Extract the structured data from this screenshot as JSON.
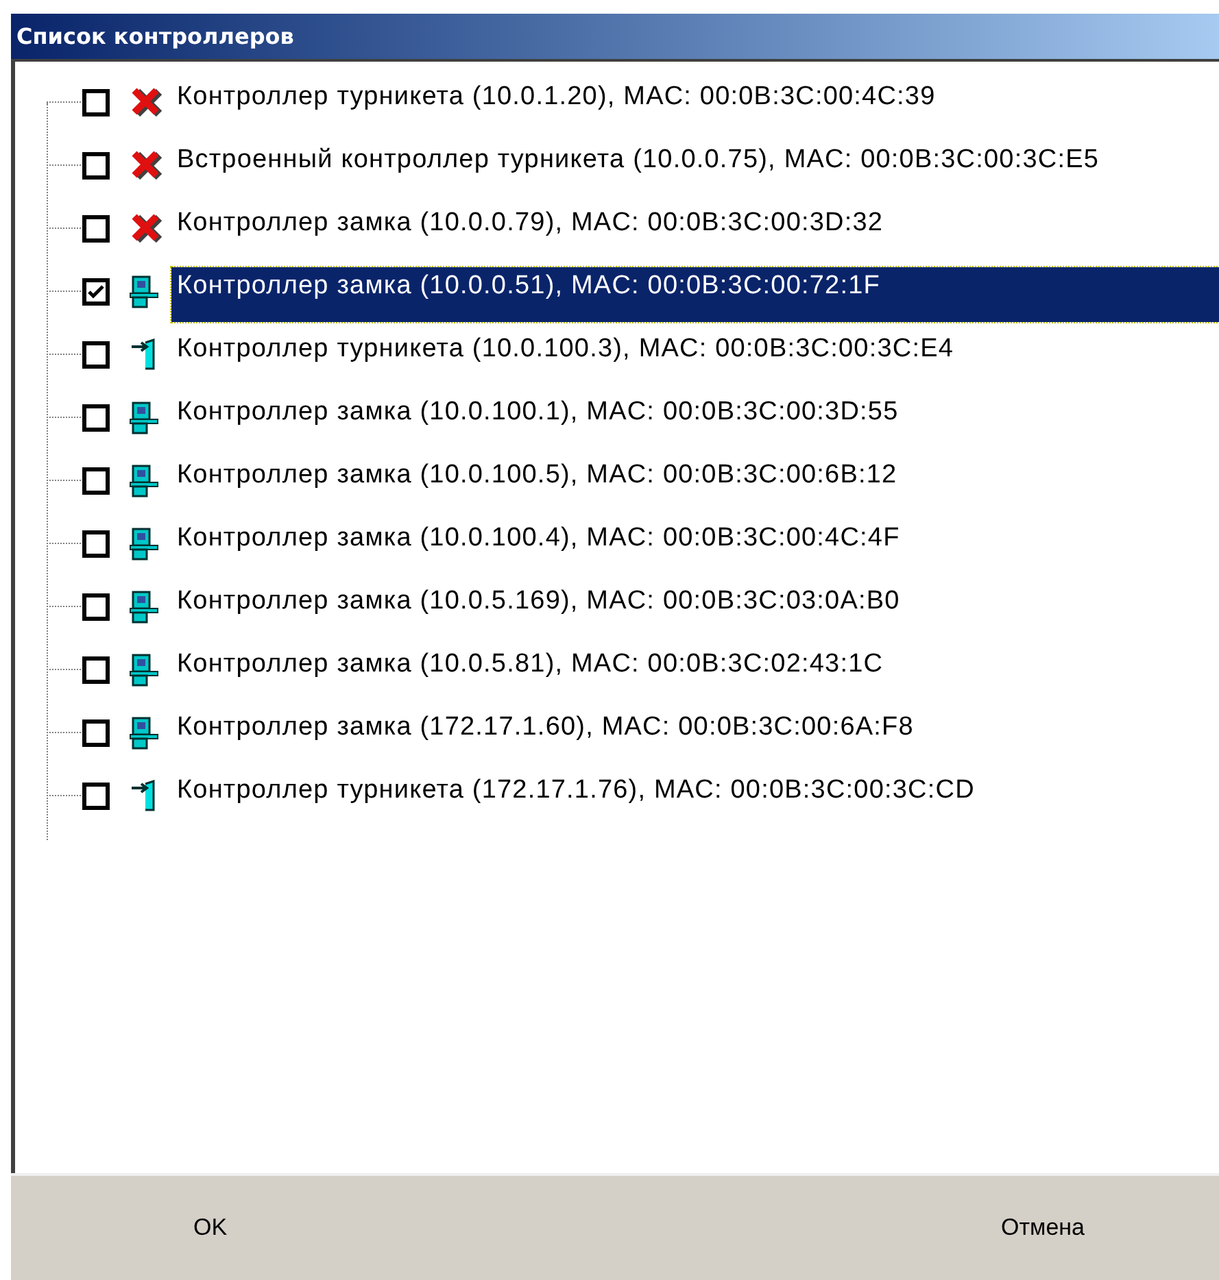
{
  "window": {
    "title": "Список контроллеров"
  },
  "controllers": [
    {
      "kind": "error",
      "label": "Контроллер турникета (10.0.1.20), MAC: 00:0B:3C:00:4C:39",
      "checked": false,
      "selected": false
    },
    {
      "kind": "error",
      "label": "Встроенный контроллер турникета (10.0.0.75), MAC: 00:0B:3C:00:3C:E5",
      "checked": false,
      "selected": false
    },
    {
      "kind": "error",
      "label": "Контроллер замка (10.0.0.79), MAC: 00:0B:3C:00:3D:32",
      "checked": false,
      "selected": false
    },
    {
      "kind": "lock",
      "label": "Контроллер замка (10.0.0.51), MAC: 00:0B:3C:00:72:1F",
      "checked": true,
      "selected": true
    },
    {
      "kind": "turnstile",
      "label": "Контроллер турникета (10.0.100.3), MAC: 00:0B:3C:00:3C:E4",
      "checked": false,
      "selected": false
    },
    {
      "kind": "lock",
      "label": "Контроллер замка (10.0.100.1), MAC: 00:0B:3C:00:3D:55",
      "checked": false,
      "selected": false
    },
    {
      "kind": "lock",
      "label": "Контроллер замка (10.0.100.5), MAC: 00:0B:3C:00:6B:12",
      "checked": false,
      "selected": false
    },
    {
      "kind": "lock",
      "label": "Контроллер замка (10.0.100.4), MAC: 00:0B:3C:00:4C:4F",
      "checked": false,
      "selected": false
    },
    {
      "kind": "lock",
      "label": "Контроллер замка (10.0.5.169), MAC: 00:0B:3C:03:0A:B0",
      "checked": false,
      "selected": false
    },
    {
      "kind": "lock",
      "label": "Контроллер замка (10.0.5.81), MAC: 00:0B:3C:02:43:1C",
      "checked": false,
      "selected": false
    },
    {
      "kind": "lock",
      "label": "Контроллер замка (172.17.1.60), MAC: 00:0B:3C:00:6A:F8",
      "checked": false,
      "selected": false
    },
    {
      "kind": "turnstile",
      "label": "Контроллер турникета (172.17.1.76), MAC: 00:0B:3C:00:3C:CD",
      "checked": false,
      "selected": false
    }
  ],
  "buttons": [
    "OK",
    "Отмена"
  ]
}
